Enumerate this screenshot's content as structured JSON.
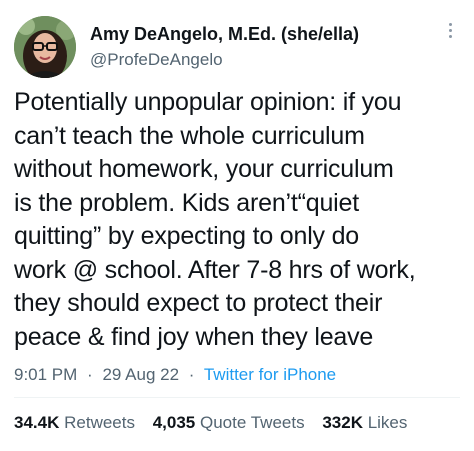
{
  "author": {
    "display_name": "Amy DeAngelo, M.Ed. (she/ella)",
    "handle": "@ProfeDeAngelo"
  },
  "tweet": {
    "lines": [
      "Potentially unpopular opinion: if you",
      "can’t teach the whole curriculum",
      "without homework, your curriculum",
      "is the problem. Kids aren’t“quiet",
      "quitting” by expecting to only do",
      "work @ school. After 7-8 hrs of work,",
      "they should expect to protect their",
      "peace & find joy when they leave"
    ],
    "time": "9:01 PM",
    "date": "29 Aug 22",
    "source": "Twitter for iPhone",
    "separator": "·"
  },
  "stats": {
    "retweets_count": "34.4K",
    "retweets_label": "Retweets",
    "quotes_count": "4,035",
    "quotes_label": "Quote Tweets",
    "likes_count": "332K",
    "likes_label": "Likes"
  },
  "icons": {
    "more": "more-options-icon"
  },
  "colors": {
    "text": "#0f1419",
    "secondary": "#536471",
    "link": "#1d9bf0",
    "divider": "#eff3f4"
  }
}
